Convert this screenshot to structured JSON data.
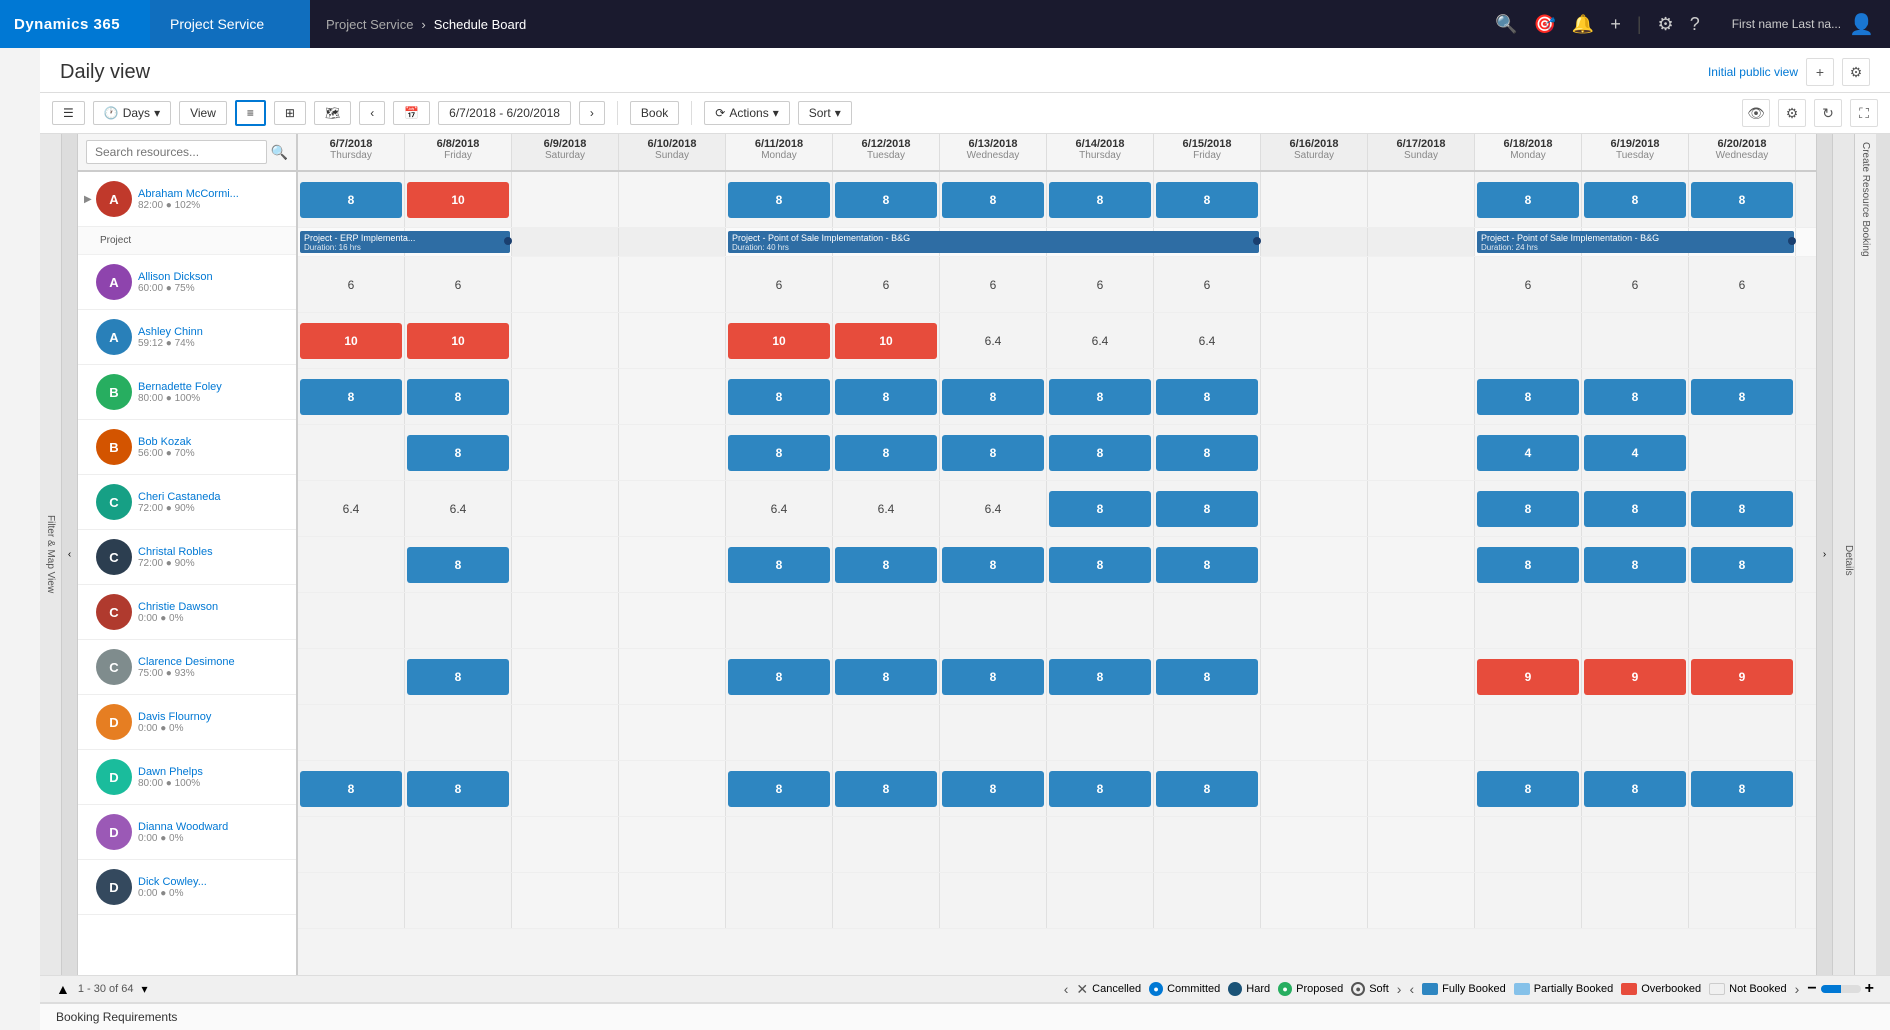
{
  "topNav": {
    "d365": "Dynamics 365",
    "app": "Project Service",
    "breadcrumb1": "Project Service",
    "breadcrumb2": "Schedule Board",
    "searchIcon": "🔍",
    "settingsIcon": "⚙",
    "questionIcon": "?",
    "plusIcon": "+",
    "flagIcon": "🏳",
    "userText": "First name Last na...",
    "userIcon": "👤"
  },
  "header": {
    "title": "Daily view",
    "initialPublicView": "Initial public view",
    "plusIcon": "+",
    "settingsIcon": "⚙"
  },
  "toolbar": {
    "daysLabel": "Days",
    "viewLabel": "View",
    "dateRange": "6/7/2018 - 6/20/2018",
    "bookLabel": "Book",
    "actionsLabel": "Actions",
    "sortLabel": "Sort"
  },
  "dates": [
    {
      "date": "6/7/2018",
      "day": "Thursday",
      "weekend": false
    },
    {
      "date": "6/8/2018",
      "day": "Friday",
      "weekend": false
    },
    {
      "date": "6/9/2018",
      "day": "Saturday",
      "weekend": true
    },
    {
      "date": "6/10/2018",
      "day": "Sunday",
      "weekend": true
    },
    {
      "date": "6/11/2018",
      "day": "Monday",
      "weekend": false
    },
    {
      "date": "6/12/2018",
      "day": "Tuesday",
      "weekend": false
    },
    {
      "date": "6/13/2018",
      "day": "Wednesday",
      "weekend": false
    },
    {
      "date": "6/14/2018",
      "day": "Thursday",
      "weekend": false
    },
    {
      "date": "6/15/2018",
      "day": "Friday",
      "weekend": false
    },
    {
      "date": "6/16/2018",
      "day": "Saturday",
      "weekend": true
    },
    {
      "date": "6/17/2018",
      "day": "Sunday",
      "weekend": true
    },
    {
      "date": "6/18/2018",
      "day": "Monday",
      "weekend": false
    },
    {
      "date": "6/19/2018",
      "day": "Tuesday",
      "weekend": false
    },
    {
      "date": "6/20/2018",
      "day": "Wednesday",
      "weekend": false
    }
  ],
  "resources": [
    {
      "name": "Abraham McCormi...",
      "meta": "82:00 ● 102%",
      "subLabel": "Project",
      "av": "av-1",
      "cells": [
        "8",
        "10",
        "",
        "",
        "8",
        "8",
        "8",
        "8",
        "8",
        "",
        "",
        "8",
        "8",
        "8"
      ],
      "cellTypes": [
        "blue",
        "red",
        "",
        "",
        "blue",
        "blue",
        "blue",
        "blue",
        "blue",
        "",
        "",
        "blue",
        "blue",
        "blue"
      ],
      "projectBars": [
        {
          "startIdx": 0,
          "span": 2,
          "label": "Project - ERP Implementa...",
          "sublabel": "Duration: 16 hrs"
        },
        {
          "startIdx": 4,
          "span": 5,
          "label": "Project - Point of Sale Implementation - B&G",
          "sublabel": "Duration: 40 hrs"
        },
        {
          "startIdx": 11,
          "span": 3,
          "label": "Project - Point of Sale Implementation - B&G",
          "sublabel": "Duration: 24 hrs"
        }
      ]
    },
    {
      "name": "Allison Dickson",
      "meta": "60:00 ● 75%",
      "av": "av-2",
      "cells": [
        "6",
        "6",
        "",
        "",
        "6",
        "6",
        "6",
        "6",
        "6",
        "",
        "",
        "6",
        "6",
        "6"
      ],
      "cellTypes": [
        "",
        "",
        "",
        "",
        "",
        "",
        "",
        "",
        "",
        "",
        "",
        "",
        "",
        ""
      ]
    },
    {
      "name": "Ashley Chinn",
      "meta": "59:12 ● 74%",
      "av": "av-3",
      "cells": [
        "10",
        "10",
        "",
        "",
        "10",
        "10",
        "6.4",
        "6.4",
        "6.4",
        "",
        "",
        "",
        "",
        ""
      ],
      "cellTypes": [
        "red",
        "red",
        "",
        "",
        "red",
        "red",
        "",
        "",
        "",
        "",
        "",
        "",
        "",
        ""
      ]
    },
    {
      "name": "Bernadette Foley",
      "meta": "80:00 ● 100%",
      "av": "av-4",
      "cells": [
        "8",
        "8",
        "",
        "",
        "8",
        "8",
        "8",
        "8",
        "8",
        "",
        "",
        "8",
        "8",
        "8"
      ],
      "cellTypes": [
        "blue",
        "blue",
        "",
        "",
        "blue",
        "blue",
        "blue",
        "blue",
        "blue",
        "",
        "",
        "blue",
        "blue",
        "blue"
      ]
    },
    {
      "name": "Bob Kozak",
      "meta": "56:00 ● 70%",
      "av": "av-5",
      "cells": [
        "",
        "8",
        "",
        "",
        "8",
        "8",
        "8",
        "8",
        "8",
        "",
        "",
        "4",
        "4",
        ""
      ],
      "cellTypes": [
        "",
        "blue",
        "",
        "",
        "blue",
        "blue",
        "blue",
        "blue",
        "blue",
        "",
        "",
        "blue",
        "blue",
        ""
      ]
    },
    {
      "name": "Cheri Castaneda",
      "meta": "72:00 ● 90%",
      "av": "av-6",
      "cells": [
        "6.4",
        "6.4",
        "",
        "",
        "6.4",
        "6.4",
        "6.4",
        "8",
        "8",
        "",
        "",
        "8",
        "8",
        "8"
      ],
      "cellTypes": [
        "",
        "",
        "",
        "",
        "",
        "",
        "",
        "blue",
        "blue",
        "",
        "",
        "blue",
        "blue",
        "blue"
      ]
    },
    {
      "name": "Christal Robles",
      "meta": "72:00 ● 90%",
      "av": "av-7",
      "cells": [
        "",
        "8",
        "",
        "",
        "8",
        "8",
        "8",
        "8",
        "8",
        "",
        "",
        "8",
        "8",
        "8"
      ],
      "cellTypes": [
        "",
        "blue",
        "",
        "",
        "blue",
        "blue",
        "blue",
        "blue",
        "blue",
        "",
        "",
        "blue",
        "blue",
        "blue"
      ]
    },
    {
      "name": "Christie Dawson",
      "meta": "0:00 ● 0%",
      "av": "av-8",
      "cells": [
        "",
        "",
        "",
        "",
        "",
        "",
        "",
        "",
        "",
        "",
        "",
        "",
        "",
        ""
      ],
      "cellTypes": [
        "",
        "",
        "",
        "",
        "",
        "",
        "",
        "",
        "",
        "",
        "",
        "",
        "",
        ""
      ]
    },
    {
      "name": "Clarence Desimone",
      "meta": "75:00 ● 93%",
      "av": "av-9",
      "cells": [
        "",
        "8",
        "",
        "",
        "8",
        "8",
        "8",
        "8",
        "8",
        "",
        "",
        "9",
        "9",
        "9"
      ],
      "cellTypes": [
        "",
        "blue",
        "",
        "",
        "blue",
        "blue",
        "blue",
        "blue",
        "blue",
        "",
        "",
        "red",
        "red",
        "red"
      ]
    },
    {
      "name": "Davis Flournoy",
      "meta": "0:00 ● 0%",
      "av": "av-10",
      "cells": [
        "",
        "",
        "",
        "",
        "",
        "",
        "",
        "",
        "",
        "",
        "",
        "",
        "",
        ""
      ],
      "cellTypes": [
        "",
        "",
        "",
        "",
        "",
        "",
        "",
        "",
        "",
        "",
        "",
        "",
        "",
        ""
      ]
    },
    {
      "name": "Dawn Phelps",
      "meta": "80:00 ● 100%",
      "av": "av-11",
      "cells": [
        "8",
        "8",
        "",
        "",
        "8",
        "8",
        "8",
        "8",
        "8",
        "",
        "",
        "8",
        "8",
        "8"
      ],
      "cellTypes": [
        "blue",
        "blue",
        "",
        "",
        "blue",
        "blue",
        "blue",
        "blue",
        "blue",
        "",
        "",
        "blue",
        "blue",
        "blue"
      ]
    },
    {
      "name": "Dianna Woodward",
      "meta": "0:00 ● 0%",
      "av": "av-12",
      "cells": [
        "",
        "",
        "",
        "",
        "",
        "",
        "",
        "",
        "",
        "",
        "",
        "",
        "",
        ""
      ],
      "cellTypes": [
        "",
        "",
        "",
        "",
        "",
        "",
        "",
        "",
        "",
        "",
        "",
        "",
        "",
        ""
      ]
    },
    {
      "name": "Dick Cowley...",
      "meta": "0:00 ● 0%",
      "av": "av-13",
      "cells": [
        "",
        "",
        "",
        "",
        "",
        "",
        "",
        "",
        "",
        "",
        "",
        "",
        "",
        ""
      ],
      "cellTypes": [
        "",
        "",
        "",
        "",
        "",
        "",
        "",
        "",
        "",
        "",
        "",
        "",
        "",
        ""
      ]
    }
  ],
  "legend": {
    "cancelled": "Cancelled",
    "committed": "Committed",
    "hard": "Hard",
    "proposed": "Proposed",
    "soft": "Soft",
    "fullyBooked": "Fully Booked",
    "partiallyBooked": "Partially Booked",
    "overbooked": "Overbooked",
    "notBooked": "Not Booked"
  },
  "pagination": {
    "range": "1 - 30 of 64"
  },
  "bookingReq": {
    "label": "Booking Requirements"
  },
  "filterPanel": {
    "label": "Filter & Map View"
  },
  "rightPanel": {
    "label": "Details"
  },
  "createPanel": {
    "label": "Create Resource Booking"
  }
}
